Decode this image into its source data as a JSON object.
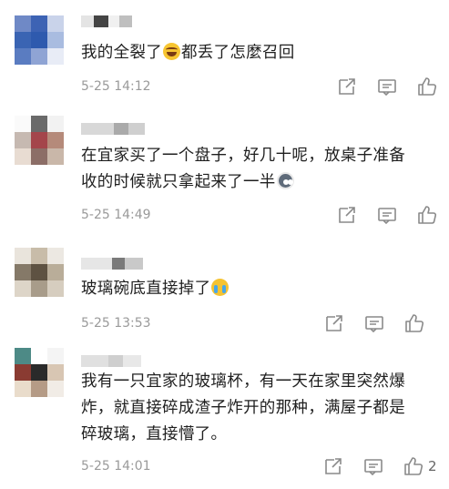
{
  "comments": [
    {
      "text_parts": [
        "我的全裂了",
        "都丢了怎麼召回"
      ],
      "emoji": "laugh",
      "time": "5-25 14:12",
      "likes": ""
    },
    {
      "text_line1": "在宜家买了一个盘子，好几十呢，放桌子准备",
      "text_line2": "收的时候就只拿起来了一半",
      "emoji": "dog",
      "time": "5-25 14:49",
      "likes": ""
    },
    {
      "text": "玻璃碗底直接掉了",
      "emoji": "cry",
      "time": "5-25 13:53",
      "likes": ""
    },
    {
      "text_line1": "我有一只宜家的玻璃杯，有一天在家里突然爆",
      "text_line2": "炸，就直接碎成渣子炸开的那种，满屋子都是",
      "text_line3": "碎玻璃，直接懵了。",
      "time": "5-25 14:01",
      "likes": "2"
    }
  ],
  "icons": {
    "share": "share-icon",
    "reply": "comment-icon",
    "like": "thumbs-up-icon"
  },
  "colors": {
    "text": "#1f1f1f",
    "meta": "#9a9a9a",
    "icon": "#8a8a8a"
  }
}
